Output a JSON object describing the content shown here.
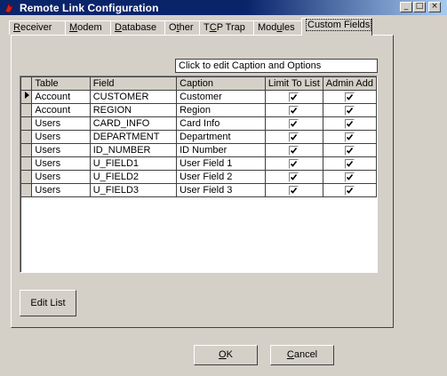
{
  "window": {
    "title": "Remote Link Configuration",
    "minimize_glyph": "_",
    "maximize_glyph": "□",
    "close_glyph": "×"
  },
  "tabs": [
    {
      "label_pre": "",
      "label_ul": "R",
      "label_post": "eceiver"
    },
    {
      "label_pre": "",
      "label_ul": "M",
      "label_post": "odem"
    },
    {
      "label_pre": "",
      "label_ul": "D",
      "label_post": "atabase"
    },
    {
      "label_pre": "O",
      "label_ul": "t",
      "label_post": "her"
    },
    {
      "label_pre": "T",
      "label_ul": "C",
      "label_post": "P Trap"
    },
    {
      "label_pre": "Mod",
      "label_ul": "u",
      "label_post": "les"
    },
    {
      "label_pre": "Custom Fields",
      "label_ul": "",
      "label_post": ""
    }
  ],
  "grid": {
    "caption_header": "Click to edit Caption and Options",
    "columns": [
      "Table",
      "Field",
      "Caption",
      "Limit To List",
      "Admin Add"
    ],
    "rows": [
      {
        "table": "Account",
        "field": "CUSTOMER",
        "caption": "Customer",
        "limit": true,
        "admin": true,
        "current": true
      },
      {
        "table": "Account",
        "field": "REGION",
        "caption": "Region",
        "limit": true,
        "admin": true,
        "current": false
      },
      {
        "table": "Users",
        "field": "CARD_INFO",
        "caption": "Card Info",
        "limit": true,
        "admin": true,
        "current": false
      },
      {
        "table": "Users",
        "field": "DEPARTMENT",
        "caption": "Department",
        "limit": true,
        "admin": true,
        "current": false
      },
      {
        "table": "Users",
        "field": "ID_NUMBER",
        "caption": "ID Number",
        "limit": true,
        "admin": true,
        "current": false
      },
      {
        "table": "Users",
        "field": "U_FIELD1",
        "caption": "User Field 1",
        "limit": true,
        "admin": true,
        "current": false
      },
      {
        "table": "Users",
        "field": "U_FIELD2",
        "caption": "User Field 2",
        "limit": true,
        "admin": true,
        "current": false
      },
      {
        "table": "Users",
        "field": "U_FIELD3",
        "caption": "User Field 3",
        "limit": true,
        "admin": true,
        "current": false
      }
    ]
  },
  "buttons": {
    "edit_list": "Edit List",
    "ok_ul": "O",
    "ok_post": "K",
    "cancel_ul": "C",
    "cancel_post": "ancel"
  }
}
